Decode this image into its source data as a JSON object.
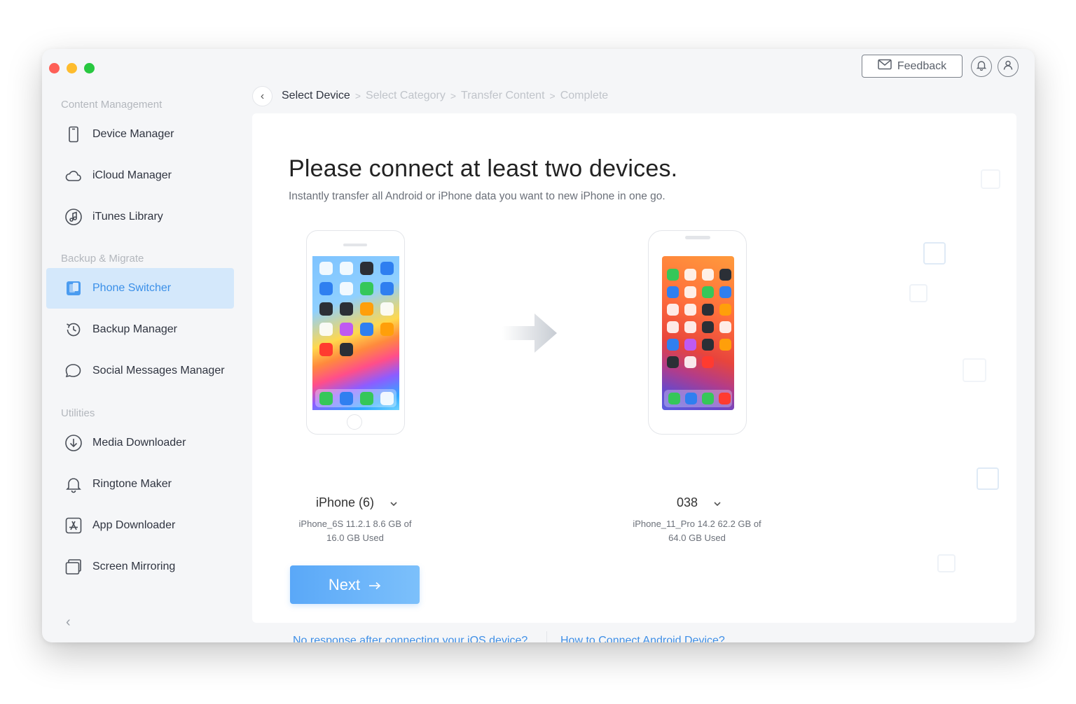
{
  "header": {
    "feedback_label": "Feedback",
    "icons": [
      "envelope-icon",
      "bell-icon",
      "user-icon"
    ]
  },
  "sidebar": {
    "sections": [
      {
        "label": "Content Management"
      },
      {
        "label": "Backup & Migrate"
      },
      {
        "label": "Utilities"
      }
    ],
    "items": [
      {
        "label": "Device Manager",
        "icon": "phone-icon"
      },
      {
        "label": "iCloud Manager",
        "icon": "cloud-icon"
      },
      {
        "label": "iTunes Library",
        "icon": "music-icon"
      },
      {
        "label": "Phone Switcher",
        "icon": "phone-switcher-icon",
        "active": true
      },
      {
        "label": "Backup Manager",
        "icon": "history-icon"
      },
      {
        "label": "Social Messages Manager",
        "icon": "chat-icon"
      },
      {
        "label": "Media Downloader",
        "icon": "download-icon"
      },
      {
        "label": "Ringtone Maker",
        "icon": "bell-icon"
      },
      {
        "label": "App Downloader",
        "icon": "app-store-icon"
      },
      {
        "label": "Screen Mirroring",
        "icon": "mirror-icon"
      }
    ]
  },
  "breadcrumb": [
    "Select Device",
    "Select Category",
    "Transfer Content",
    "Complete"
  ],
  "main": {
    "title": "Please connect at least two devices.",
    "subtitle": "Instantly transfer all Android or iPhone data you want to new iPhone in one go.",
    "source_device": {
      "name": "iPhone (6)",
      "info_line1": "iPhone_6S 11.2.1 8.6 GB of",
      "info_line2": "16.0 GB Used"
    },
    "target_device": {
      "name": "038",
      "info_line1": "iPhone_11_Pro 14.2 62.2 GB of",
      "info_line2": "64.0 GB Used"
    },
    "next_label": "Next",
    "help_link_ios": "No response after connecting your iOS device?",
    "help_link_android": "How to Connect Android Device?"
  },
  "colors": {
    "accent": "#3a8fe8",
    "active_bg": "#d4e8fb",
    "button_gradient_start": "#5aa8f8",
    "button_gradient_end": "#7cc0fb"
  }
}
